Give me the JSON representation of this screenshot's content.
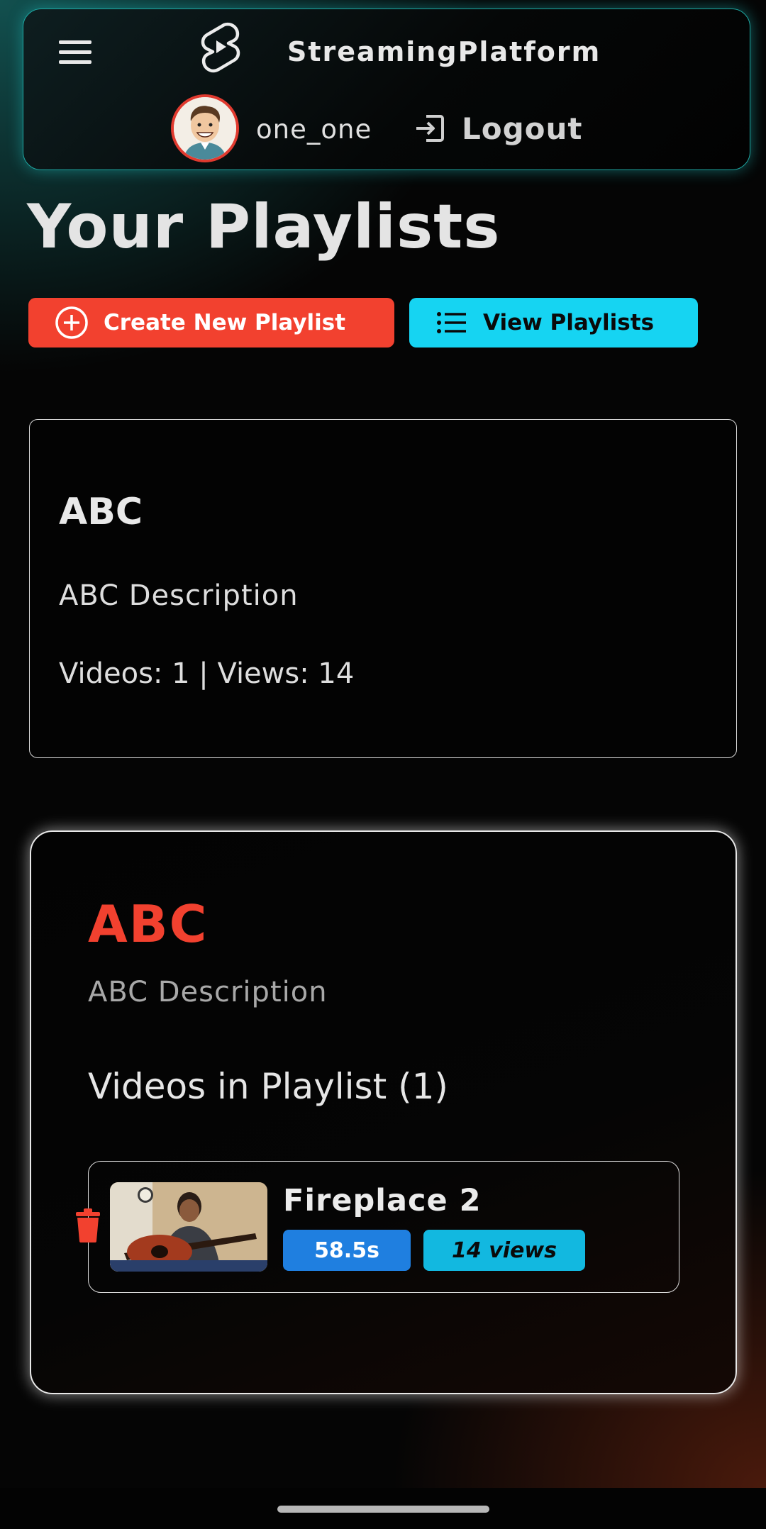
{
  "header": {
    "brand": "StreamingPlatform",
    "username": "one_one",
    "logout_label": "Logout"
  },
  "page": {
    "title": "Your Playlists",
    "create_button_label": "Create New Playlist",
    "view_button_label": "View Playlists"
  },
  "playlist_card": {
    "name": "ABC",
    "description": "ABC Description",
    "stats": "Videos: 1 | Views: 14"
  },
  "playlist_detail": {
    "name": "ABC",
    "description": "ABC Description",
    "videos_heading": "Videos in Playlist (1)",
    "videos": [
      {
        "title": "Fireplace 2",
        "duration": "58.5s",
        "views": "14 views"
      }
    ]
  },
  "colors": {
    "accent_red": "#f2412f",
    "accent_cyan": "#16d4f2",
    "badge_blue": "#1f7fe0",
    "header_glow": "#1ea7a2"
  },
  "icons": {
    "menu": "hamburger-icon",
    "logo": "shorts-logo-icon",
    "logout": "logout-icon",
    "create": "plus-circle-icon",
    "view": "list-icon",
    "delete": "trash-icon"
  }
}
